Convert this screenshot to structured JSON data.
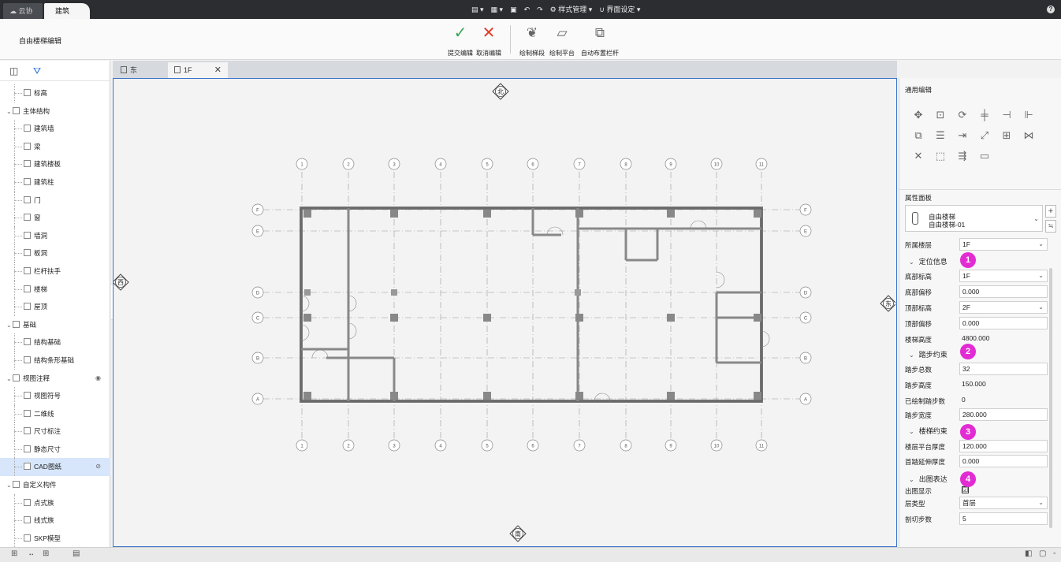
{
  "app": {
    "tabs": [
      {
        "label": "云协同",
        "active": false
      },
      {
        "label": "建筑",
        "active": true
      }
    ],
    "quick_access": {
      "style_manager": "样式管理",
      "ui_settings": "界面设定"
    }
  },
  "ribbon": {
    "mode_title": "自由楼梯编辑",
    "commit_label": "提交编辑",
    "cancel_label": "取消编辑",
    "draw_flight_label": "绘制梯段",
    "draw_platform_label": "绘制平台",
    "auto_railing_label": "自动布置栏杆"
  },
  "tree": {
    "items": [
      {
        "label": "标高",
        "level": 2
      },
      {
        "label": "主体结构",
        "level": 1
      },
      {
        "label": "建筑墙",
        "level": 2
      },
      {
        "label": "梁",
        "level": 2
      },
      {
        "label": "建筑楼板",
        "level": 2
      },
      {
        "label": "建筑柱",
        "level": 2
      },
      {
        "label": "门",
        "level": 2
      },
      {
        "label": "窗",
        "level": 2
      },
      {
        "label": "墙洞",
        "level": 2
      },
      {
        "label": "板洞",
        "level": 2
      },
      {
        "label": "栏杆扶手",
        "level": 2
      },
      {
        "label": "楼梯",
        "level": 2
      },
      {
        "label": "屋顶",
        "level": 2
      },
      {
        "label": "基础",
        "level": 1
      },
      {
        "label": "结构基础",
        "level": 2
      },
      {
        "label": "结构条形基础",
        "level": 2
      },
      {
        "label": "视图注释",
        "level": 1
      },
      {
        "label": "视图符号",
        "level": 2
      },
      {
        "label": "二维线",
        "level": 2
      },
      {
        "label": "尺寸标注",
        "level": 2
      },
      {
        "label": "静态尺寸",
        "level": 2
      },
      {
        "label": "CAD图纸",
        "level": 2
      },
      {
        "label": "自定义构件",
        "level": 1
      },
      {
        "label": "点式族",
        "level": 2
      },
      {
        "label": "线式族",
        "level": 2
      },
      {
        "label": "SKP模型",
        "level": 2
      }
    ],
    "selected": "CAD图纸"
  },
  "doc_tabs": [
    {
      "label": "东"
    },
    {
      "label": "1F"
    }
  ],
  "viewport": {
    "compass": {
      "north": "北",
      "south": "南",
      "west": "西",
      "east": "东"
    },
    "axis_numbers": [
      "1",
      "2",
      "3",
      "4",
      "5",
      "6",
      "7",
      "8",
      "9",
      "10",
      "11"
    ],
    "axis_letters": [
      "F",
      "E",
      "D",
      "C",
      "B",
      "A"
    ]
  },
  "right_panel": {
    "general_edit_title": "通用编辑",
    "properties_title": "属性面板",
    "type_name": "自由楼梯",
    "type_sub": "自由楼梯-01",
    "level_label": "所属楼层",
    "level_value": "1F",
    "groups": {
      "positioning": "定位信息",
      "tread": "踏步约束",
      "stair": "楼梯约束",
      "drawing": "出图表达"
    },
    "badges": [
      "1",
      "2",
      "3",
      "4"
    ],
    "props": {
      "base_level_label": "底部标高",
      "base_level_value": "1F",
      "base_offset_label": "底部偏移",
      "base_offset_value": "0.000",
      "top_level_label": "顶部标高",
      "top_level_value": "2F",
      "top_offset_label": "顶部偏移",
      "top_offset_value": "0.000",
      "height_label": "楼梯高度",
      "height_value": "4800.000",
      "tread_count_label": "踏步总数",
      "tread_count_value": "32",
      "tread_height_label": "踏步高度",
      "tread_height_value": "150.000",
      "drawn_label": "已绘制踏步数",
      "drawn_value": "0",
      "tread_width_label": "踏步宽度",
      "tread_width_value": "280.000",
      "slab_label": "楼层平台厚度",
      "slab_value": "120.000",
      "ext_label": "首踏延伸厚度",
      "ext_value": "0.000",
      "show_label": "出图显示",
      "show_value": "☑",
      "floor_type_label": "层类型",
      "floor_type_value": "首层",
      "cut_label": "剖切步数",
      "cut_value": "5"
    }
  }
}
